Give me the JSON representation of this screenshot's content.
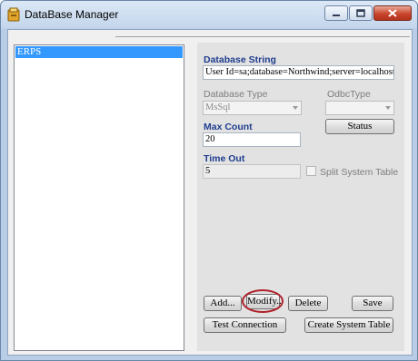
{
  "window": {
    "title": "DataBase Manager"
  },
  "titlebar": {
    "icons": [
      "app-icon",
      "minimize-icon",
      "maximize-icon",
      "close-icon"
    ]
  },
  "list": {
    "items": [
      "ERPS"
    ],
    "selected": "ERPS"
  },
  "form": {
    "database_string_label": "Database String",
    "database_string_value": "User Id=sa;database=Northwind;server=localhost;Connec",
    "database_type_label": "Database Type",
    "database_type_value": "MsSql",
    "odbc_type_label": "OdbcType",
    "odbc_type_value": "",
    "status_label": "Status",
    "max_count_label": "Max Count",
    "max_count_value": "20",
    "time_out_label": "Time Out",
    "time_out_value": "5",
    "split_system_table_label": "Split System Table",
    "split_system_table_checked": false
  },
  "buttons": {
    "add": "Add...",
    "modify": "Modify..",
    "delete": "Delete",
    "save": "Save",
    "test_connection": "Test Connection",
    "create_system_table": "Create System Table"
  },
  "colors": {
    "label_blue": "#1f3d8f",
    "selection": "#3399ff",
    "highlight_ring": "#b0202a"
  }
}
